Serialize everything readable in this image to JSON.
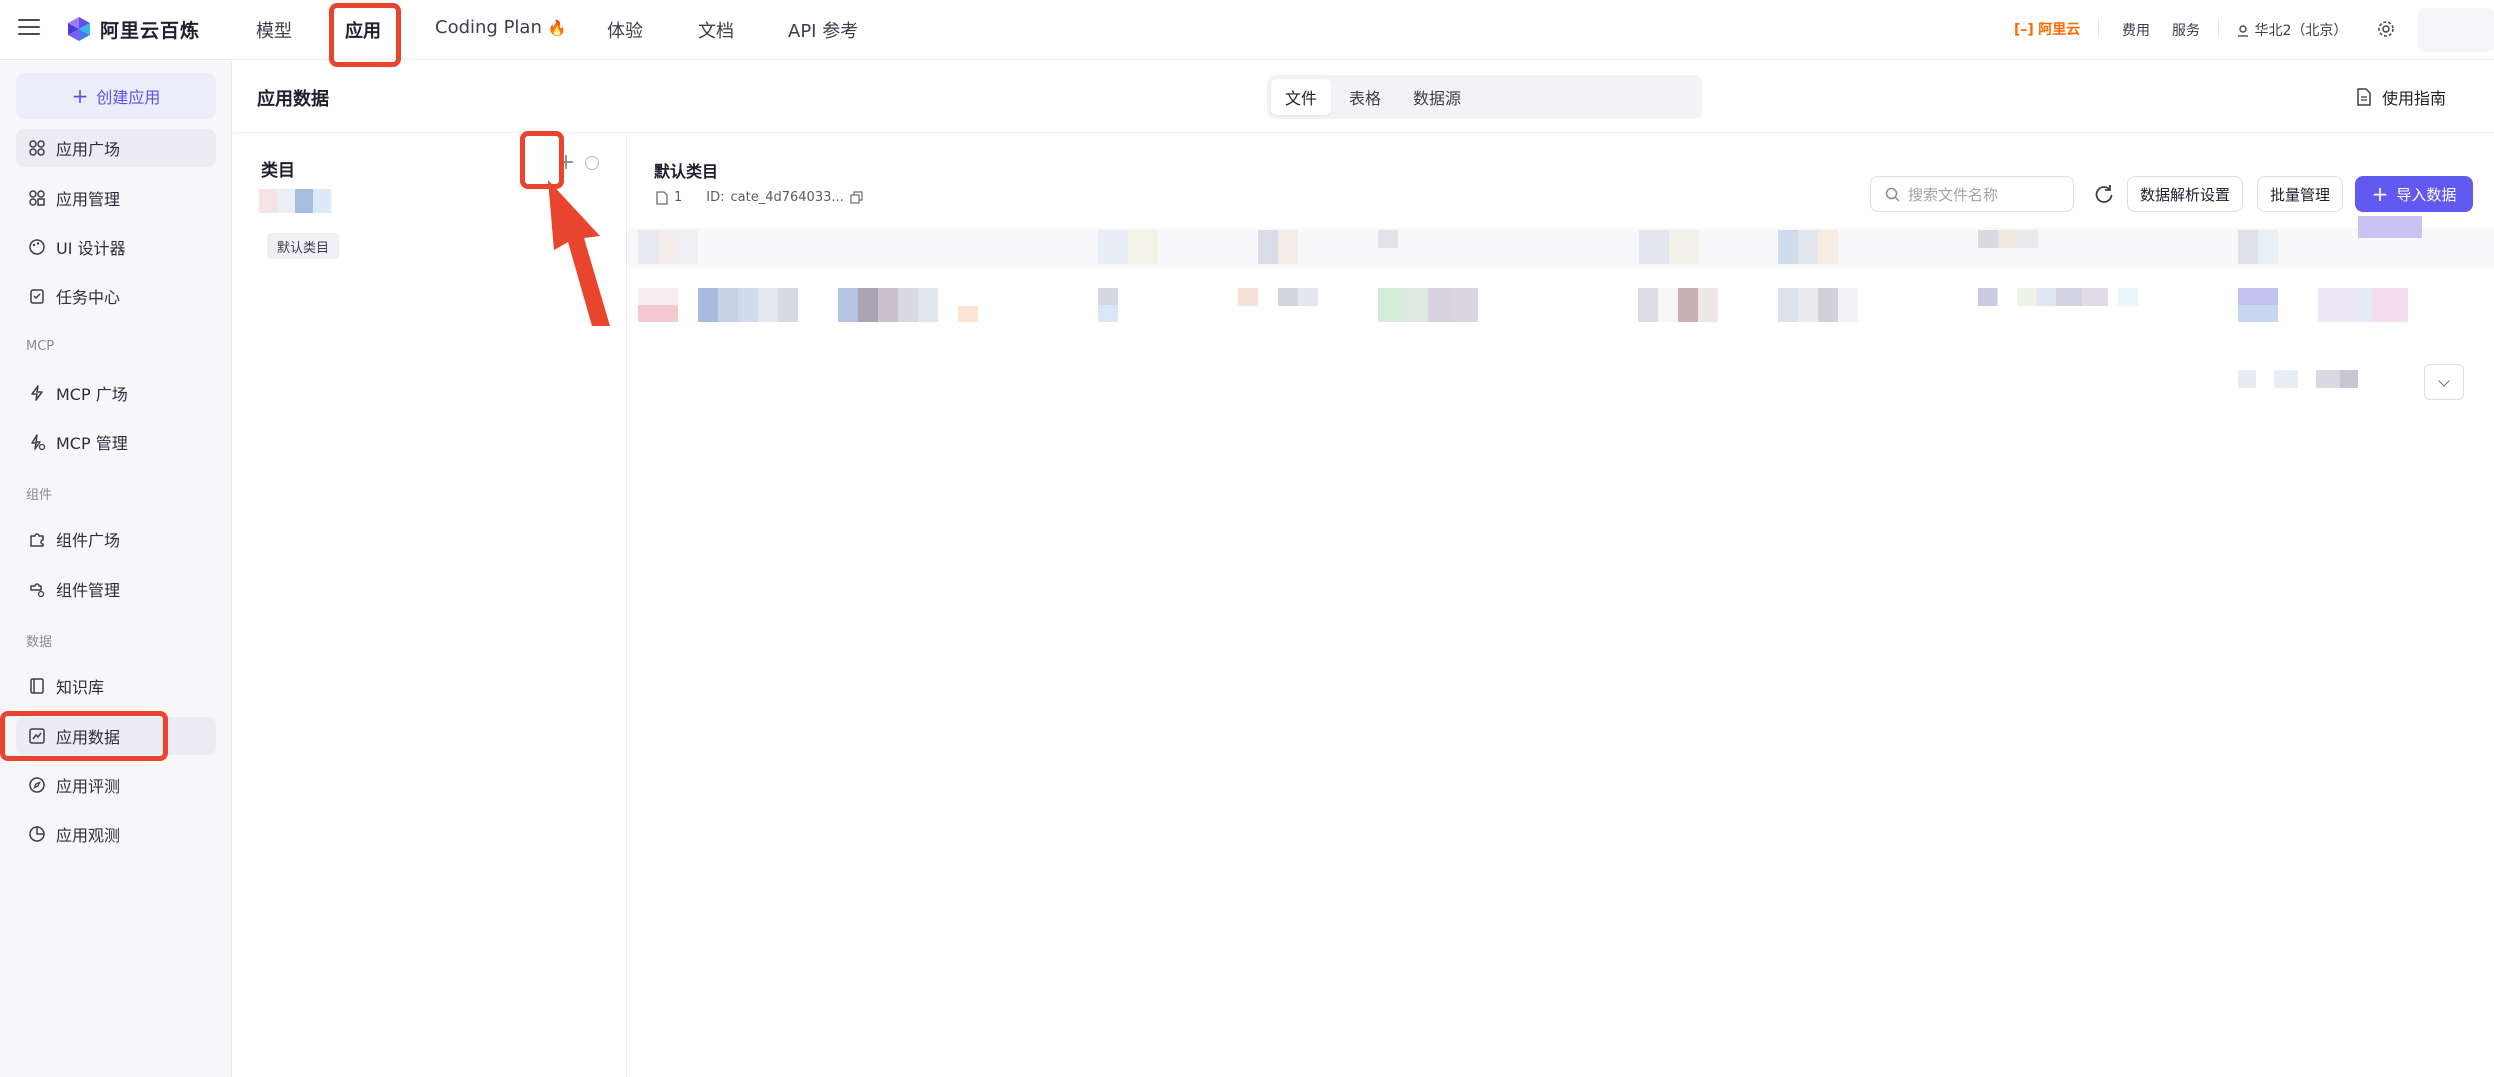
{
  "brand": {
    "name": "阿里云百炼"
  },
  "top_nav": {
    "tabs": [
      {
        "label": "模型"
      },
      {
        "label": "应用"
      },
      {
        "label": "Coding Plan"
      },
      {
        "label": "体验"
      },
      {
        "label": "文档"
      },
      {
        "label": "API 参考"
      }
    ],
    "active_tab": "应用",
    "coding_plan_badge": "🔥",
    "aliyun_label": "阿里云",
    "fee": "费用",
    "service": "服务",
    "region": "华北2（北京）"
  },
  "sidebar": {
    "create_label": "创建应用",
    "items": [
      {
        "label": "应用广场"
      },
      {
        "label": "应用管理"
      },
      {
        "label": "UI 设计器"
      },
      {
        "label": "任务中心"
      }
    ],
    "group_mcp": "MCP",
    "mcp_items": [
      {
        "label": "MCP 广场"
      },
      {
        "label": "MCP 管理"
      }
    ],
    "group_component": "组件",
    "component_items": [
      {
        "label": "组件广场"
      },
      {
        "label": "组件管理"
      }
    ],
    "group_data": "数据",
    "data_items": [
      {
        "label": "知识库"
      },
      {
        "label": "应用数据"
      },
      {
        "label": "应用评测"
      },
      {
        "label": "应用观测"
      }
    ],
    "active_item": "应用数据"
  },
  "header": {
    "title": "应用数据",
    "segments": [
      {
        "label": "文件"
      },
      {
        "label": "表格"
      },
      {
        "label": "数据源"
      }
    ],
    "active_segment": "文件",
    "guide_label": "使用指南"
  },
  "category": {
    "title": "类目",
    "add_symbol": "+",
    "default_tag": "默认类目"
  },
  "files": {
    "title": "默认类目",
    "count": "1",
    "id_label": "ID:",
    "id_value": "cate_4d764033...",
    "search_placeholder": "搜索文件名称",
    "parse_settings_label": "数据解析设置",
    "batch_label": "批量管理",
    "import_label": "导入数据"
  },
  "colors": {
    "accent": "#6259f0",
    "highlight": "#e8442e",
    "aliyun_orange": "#ff6a00"
  }
}
